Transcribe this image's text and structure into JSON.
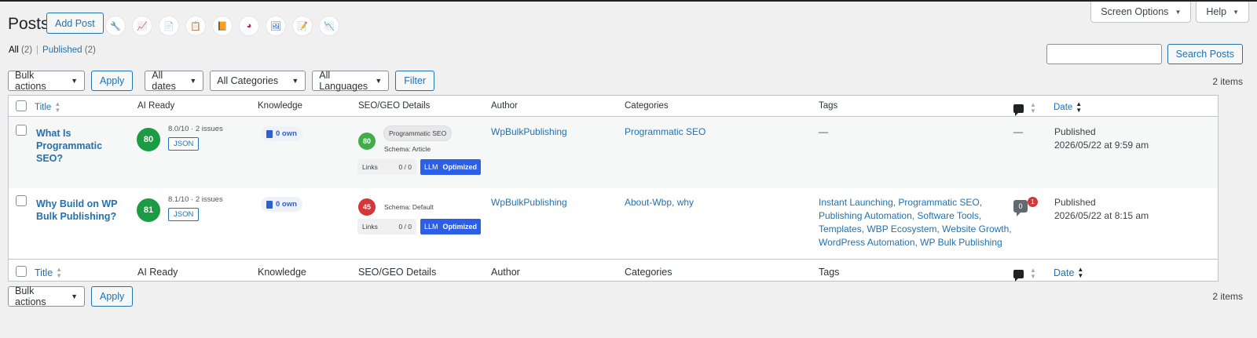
{
  "header": {
    "title": "Posts",
    "add_new_label": "Add Post",
    "screen_options_label": "Screen Options",
    "help_label": "Help",
    "quick_icons": [
      {
        "name": "wrench-icon",
        "glyph": "🔧",
        "color": "#2c5fe6"
      },
      {
        "name": "chart-line-icon",
        "glyph": "📈",
        "color": "#0f9d58"
      },
      {
        "name": "document-icon",
        "glyph": "📄",
        "color": "#7e57c2"
      },
      {
        "name": "clipboard-icon",
        "glyph": "📋",
        "color": "#e8590c"
      },
      {
        "name": "book-icon",
        "glyph": "📙",
        "color": "#b7791f"
      },
      {
        "name": "pie-chart-icon",
        "glyph": "◕",
        "color": "#c2185b"
      },
      {
        "name": "image-icon",
        "glyph": "🖼",
        "color": "#1e4ea1"
      },
      {
        "name": "edit-document-icon",
        "glyph": "📝",
        "color": "#7e57c2"
      },
      {
        "name": "trend-icon",
        "glyph": "📉",
        "color": "#9bbf3a"
      }
    ]
  },
  "filters_links": {
    "all_label": "All",
    "all_count": "(2)",
    "published_label": "Published",
    "published_count": "(2)",
    "separator": "|"
  },
  "search": {
    "button_label": "Search Posts",
    "value": ""
  },
  "tablenav_top": {
    "bulk_actions": "Bulk actions",
    "apply": "Apply",
    "dates": "All dates",
    "categories": "All Categories",
    "languages": "All Languages",
    "filter": "Filter",
    "items_count": "2 items"
  },
  "tablenav_bottom": {
    "bulk_actions": "Bulk actions",
    "apply": "Apply",
    "items_count": "2 items"
  },
  "columns": {
    "title": "Title",
    "ai_ready": "AI Ready",
    "knowledge": "Knowledge",
    "seo_geo": "SEO/GEO Details",
    "author": "Author",
    "categories": "Categories",
    "tags": "Tags",
    "date": "Date"
  },
  "rows": [
    {
      "title_line1": "What Is",
      "title_line2": "Programmatic SEO?",
      "ai_score": "80",
      "ai_meta": "8.0/10 · 2 issues",
      "json_label": "JSON",
      "knowledge": "0 own",
      "seo_score": "80",
      "seo_pill": "Programmatic SEO",
      "schema": "Schema: Article",
      "links_label": "Links",
      "links_value": "0 / 0",
      "llm_label": "LLM",
      "llm_status": "Optimized",
      "author": "WpBulkPublishing",
      "categories": "Programmatic SEO",
      "tags": "—",
      "comments": "—",
      "date_status": "Published",
      "date_value": "2026/05/22 at 9:59 am"
    },
    {
      "title_line1": "Why Build on WP",
      "title_line2": "Bulk Publishing?",
      "ai_score": "81",
      "ai_meta": "8.1/10 · 2 issues",
      "json_label": "JSON",
      "knowledge": "0 own",
      "seo_score": "45",
      "schema": "Schema: Default",
      "links_label": "Links",
      "links_value": "0 / 0",
      "llm_label": "LLM",
      "llm_status": "Optimized",
      "author": "WpBulkPublishing",
      "categories": "About-Wbp, why",
      "tags_lines": [
        "Instant Launching, Programmatic SEO,",
        "Publishing Automation, Software Tools,",
        "Templates, WBP Ecosystem, Website Growth,",
        "WordPress Automation, WP Bulk Publishing"
      ],
      "comment_count": "0",
      "pending_count": "1",
      "date_status": "Published",
      "date_value": "2026/05/22 at 8:15 am"
    }
  ]
}
